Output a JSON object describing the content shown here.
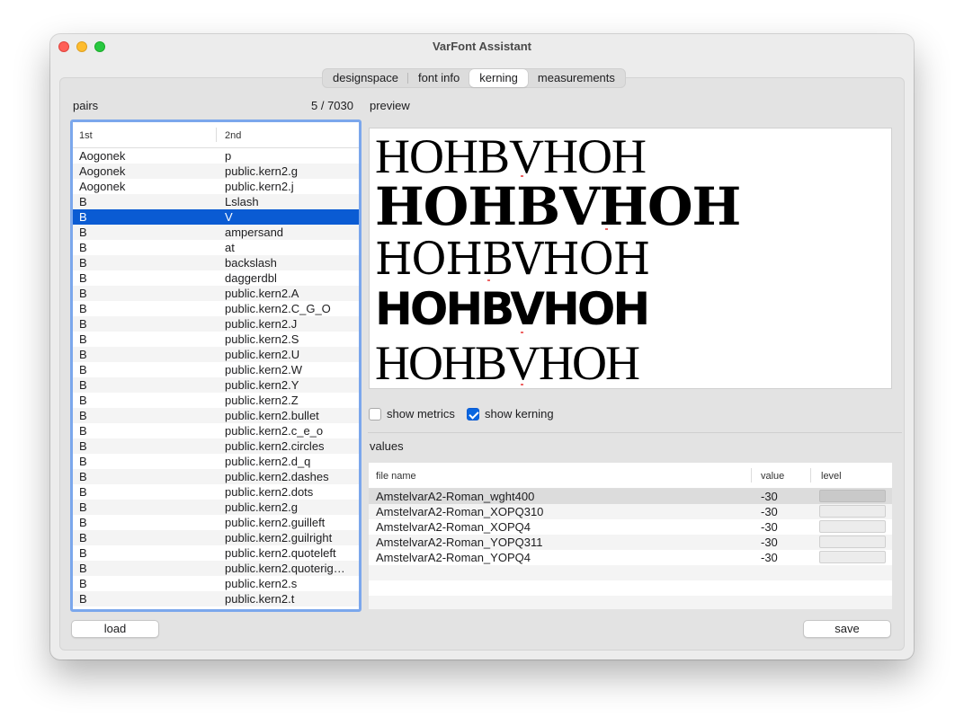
{
  "window": {
    "title": "VarFont Assistant"
  },
  "tabs": [
    {
      "label": "designspace",
      "active": false
    },
    {
      "label": "font info",
      "active": false
    },
    {
      "label": "kerning",
      "active": true
    },
    {
      "label": "measurements",
      "active": false
    }
  ],
  "pairs": {
    "label": "pairs",
    "count": "5 / 7030",
    "columns": [
      "1st",
      "2nd"
    ],
    "rows": [
      [
        "Aogonek",
        "p"
      ],
      [
        "Aogonek",
        "public.kern2.g"
      ],
      [
        "Aogonek",
        "public.kern2.j"
      ],
      [
        "B",
        "Lslash"
      ],
      [
        "B",
        "V"
      ],
      [
        "B",
        "ampersand"
      ],
      [
        "B",
        "at"
      ],
      [
        "B",
        "backslash"
      ],
      [
        "B",
        "daggerdbl"
      ],
      [
        "B",
        "public.kern2.A"
      ],
      [
        "B",
        "public.kern2.C_G_O"
      ],
      [
        "B",
        "public.kern2.J"
      ],
      [
        "B",
        "public.kern2.S"
      ],
      [
        "B",
        "public.kern2.U"
      ],
      [
        "B",
        "public.kern2.W"
      ],
      [
        "B",
        "public.kern2.Y"
      ],
      [
        "B",
        "public.kern2.Z"
      ],
      [
        "B",
        "public.kern2.bullet"
      ],
      [
        "B",
        "public.kern2.c_e_o"
      ],
      [
        "B",
        "public.kern2.circles"
      ],
      [
        "B",
        "public.kern2.d_q"
      ],
      [
        "B",
        "public.kern2.dashes"
      ],
      [
        "B",
        "public.kern2.dots"
      ],
      [
        "B",
        "public.kern2.g"
      ],
      [
        "B",
        "public.kern2.guilleft"
      ],
      [
        "B",
        "public.kern2.guilright"
      ],
      [
        "B",
        "public.kern2.quoteleft"
      ],
      [
        "B",
        "public.kern2.quoterig…"
      ],
      [
        "B",
        "public.kern2.s"
      ],
      [
        "B",
        "public.kern2.t"
      ]
    ],
    "selected_row": "B / V"
  },
  "preview": {
    "label": "preview",
    "lines": [
      "HOHBVHOH",
      "HOHBVHOH",
      "HOHBVHOH",
      "HOHBVHOH",
      "HOHBVHOH"
    ]
  },
  "options": {
    "show_metrics": {
      "label": "show metrics",
      "checked": false
    },
    "show_kerning": {
      "label": "show kerning",
      "checked": true
    }
  },
  "values": {
    "label": "values",
    "columns": [
      "file name",
      "value",
      "level"
    ],
    "rows": [
      {
        "file": "AmstelvarA2-Roman_wght400",
        "value": "-30"
      },
      {
        "file": "AmstelvarA2-Roman_XOPQ310",
        "value": "-30"
      },
      {
        "file": "AmstelvarA2-Roman_XOPQ4",
        "value": "-30"
      },
      {
        "file": "AmstelvarA2-Roman_YOPQ311",
        "value": "-30"
      },
      {
        "file": "AmstelvarA2-Roman_YOPQ4",
        "value": "-30"
      }
    ]
  },
  "buttons": {
    "load": "load",
    "save": "save"
  },
  "colors": {
    "selection": "#0a5bd3",
    "checkbox": "#0a66e0",
    "focus_ring": "#7ba7ec"
  }
}
